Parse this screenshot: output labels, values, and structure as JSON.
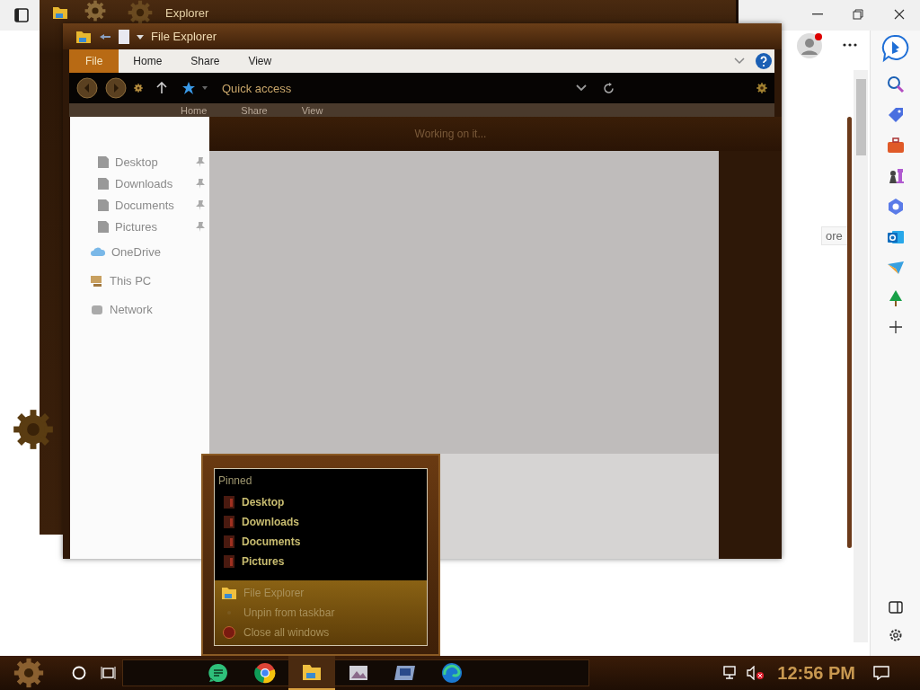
{
  "browser": {
    "page_fragment": "ore"
  },
  "back_window": {
    "title": "Explorer",
    "ribbon_tabs": [
      "Home",
      "Share",
      "View"
    ]
  },
  "window": {
    "title": "File Explorer",
    "ribbon_tabs": [
      {
        "label": "File",
        "selected": true
      },
      {
        "label": "Home",
        "selected": false
      },
      {
        "label": "Share",
        "selected": false
      },
      {
        "label": "View",
        "selected": false
      }
    ],
    "address": "Quick access",
    "status": "Working on it...",
    "nav_pane": [
      {
        "label": "Desktop",
        "pinned": true
      },
      {
        "label": "Downloads",
        "pinned": true
      },
      {
        "label": "Documents",
        "pinned": true
      },
      {
        "label": "Pictures",
        "pinned": true
      },
      {
        "label": "OneDrive",
        "pinned": false
      },
      {
        "label": "This PC",
        "pinned": false
      },
      {
        "label": "Network",
        "pinned": false
      }
    ]
  },
  "jump_list": {
    "heading": "Pinned",
    "pinned": [
      "Desktop",
      "Downloads",
      "Documents",
      "Pictures"
    ],
    "tasks": [
      "File Explorer",
      "Unpin from taskbar",
      "Close all windows"
    ]
  },
  "taskbar": {
    "clock": "12:56 PM"
  }
}
